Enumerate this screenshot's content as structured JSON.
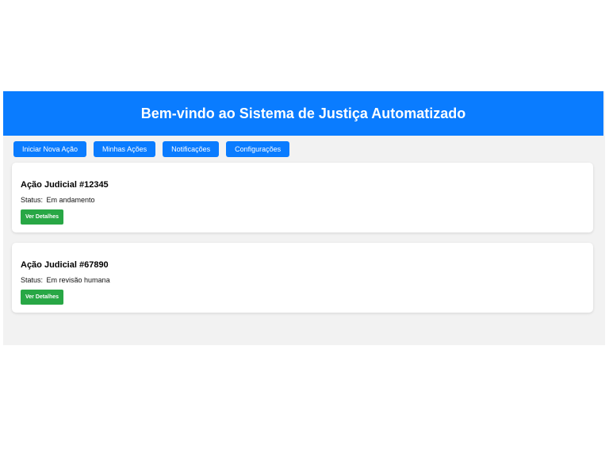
{
  "header": {
    "title": "Bem-vindo ao Sistema de Justiça Automatizado"
  },
  "nav": {
    "items": [
      {
        "label": "Iniciar Nova Ação"
      },
      {
        "label": "Minhas Ações"
      },
      {
        "label": "Notificações"
      },
      {
        "label": "Configurações"
      }
    ]
  },
  "cases": [
    {
      "title": "Ação Judicial #12345",
      "status_label": "Status:",
      "status": "Em andamento",
      "button_label": "Ver Detalhes"
    },
    {
      "title": "Ação Judicial #67890",
      "status_label": "Status:",
      "status": "Em revisão humana",
      "button_label": "Ver Detalhes"
    }
  ],
  "colors": {
    "primary": "#0a7cff",
    "success": "#28a745",
    "background": "#f2f2f2",
    "card": "#ffffff"
  }
}
